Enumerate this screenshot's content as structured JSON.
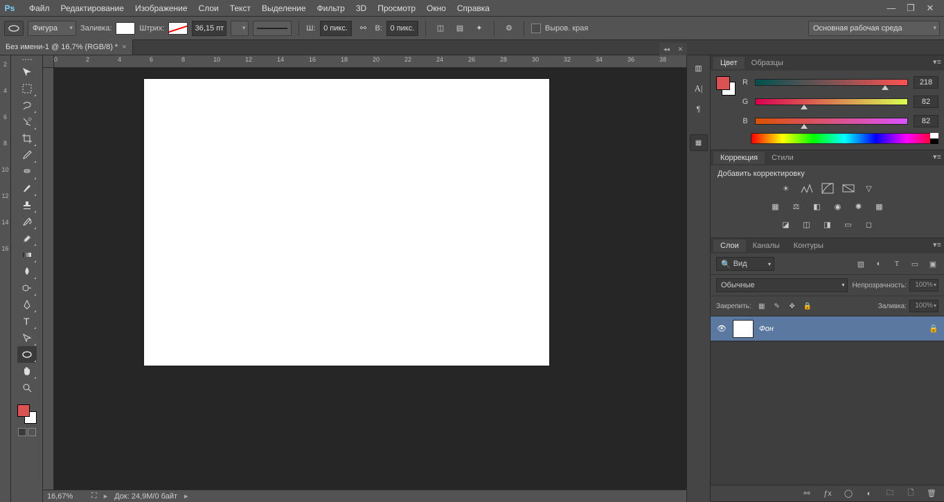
{
  "app": {
    "logo": "Ps"
  },
  "menu": [
    "Файл",
    "Редактирование",
    "Изображение",
    "Слои",
    "Текст",
    "Выделение",
    "Фильтр",
    "3D",
    "Просмотр",
    "Окно",
    "Справка"
  ],
  "options": {
    "shape_mode": "Фигура",
    "fill_label": "Заливка:",
    "stroke_label": "Штрих:",
    "stroke_size": "36,15 пт",
    "w_label": "Ш:",
    "w_value": "0 пикс.",
    "h_label": "В:",
    "h_value": "0 пикс.",
    "align_edges_label": "Выров. края",
    "workspace": "Основная рабочая среда"
  },
  "document": {
    "tab_title": "Без имени-1 @ 16,7% (RGB/8) *",
    "zoom": "16,67%",
    "doc_info": "Док: 24,9M/0 байт"
  },
  "ruler": {
    "ticks": [
      0,
      2,
      4,
      6,
      8,
      10,
      12,
      14,
      16,
      18,
      20,
      22,
      24,
      26,
      28,
      30,
      32,
      34,
      36,
      38
    ],
    "vticks": [
      2,
      4,
      6,
      8,
      10,
      12,
      14,
      16
    ]
  },
  "panels": {
    "color": {
      "tabs": [
        "Цвет",
        "Образцы"
      ],
      "r_label": "R",
      "g_label": "G",
      "b_label": "B",
      "r": "218",
      "g": "82",
      "b": "82"
    },
    "adjust": {
      "tabs": [
        "Коррекция",
        "Стили"
      ],
      "add_label": "Добавить корректировку"
    },
    "layers": {
      "tabs": [
        "Слои",
        "Каналы",
        "Контуры"
      ],
      "kind": "Вид",
      "blend": "Обычные",
      "opacity_label": "Непрозрачность:",
      "opacity": "100%",
      "lock_label": "Закрепить:",
      "fill_label": "Заливка:",
      "fill": "100%",
      "layer0_name": "Фон"
    }
  }
}
